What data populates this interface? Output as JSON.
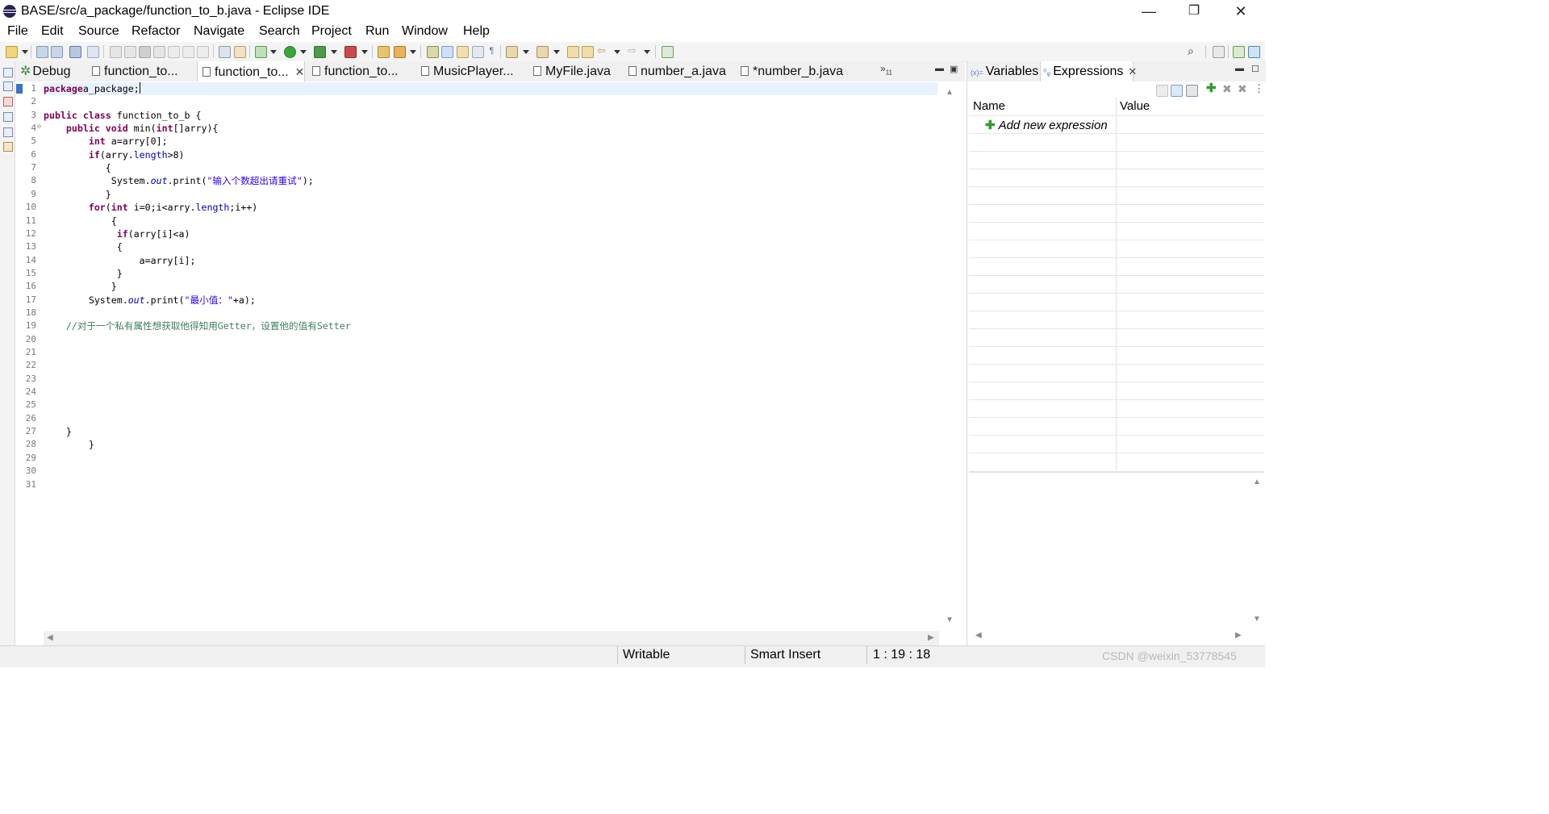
{
  "window": {
    "title": "BASE/src/a_package/function_to_b.java - Eclipse IDE",
    "controls": {
      "minimize": "—",
      "restore": "❐",
      "close": "✕"
    }
  },
  "menubar": [
    "File",
    "Edit",
    "Source",
    "Refactor",
    "Navigate",
    "Search",
    "Project",
    "Run",
    "Window",
    "Help"
  ],
  "editor_tabs": [
    {
      "label": "Debug",
      "icon": "debug-icon"
    },
    {
      "label": "function_to...",
      "icon": "java-file-icon"
    },
    {
      "label": "function_to...",
      "icon": "java-file-icon",
      "active": true,
      "close": "✕"
    },
    {
      "label": "function_to...",
      "icon": "java-file-icon"
    },
    {
      "label": "MusicPlayer...",
      "icon": "java-file-icon"
    },
    {
      "label": "MyFile.java",
      "icon": "java-file-icon"
    },
    {
      "label": "number_a.java",
      "icon": "java-file-icon"
    },
    {
      "label": "*number_b.java",
      "icon": "java-file-icon"
    }
  ],
  "more_tabs": {
    "glyph": "»",
    "count": "11"
  },
  "editor": {
    "line_numbers": [
      "1",
      "2",
      "3",
      "4",
      "5",
      "6",
      "7",
      "8",
      "9",
      "10",
      "11",
      "12",
      "13",
      "14",
      "15",
      "16",
      "17",
      "18",
      "19",
      "20",
      "21",
      "22",
      "23",
      "24",
      "25",
      "26",
      "27",
      "28",
      "29",
      "30",
      "31"
    ],
    "lines": [
      [
        [
          "kw",
          "package"
        ],
        [
          "",
          "a_package;"
        ]
      ],
      [],
      [
        [
          "kw",
          "public class"
        ],
        [
          "",
          " function_to_b {"
        ]
      ],
      [
        [
          "",
          "    "
        ],
        [
          "kw",
          "public void"
        ],
        [
          "",
          " min("
        ],
        [
          "kw",
          "int"
        ],
        [
          "",
          "[]arry){"
        ]
      ],
      [
        [
          "",
          "        "
        ],
        [
          "kw",
          "int"
        ],
        [
          "",
          " a=arry[0];"
        ]
      ],
      [
        [
          "",
          "        "
        ],
        [
          "kw",
          "if"
        ],
        [
          "",
          "(arry."
        ],
        [
          "fld",
          "length"
        ],
        [
          "",
          ">8)"
        ]
      ],
      [
        [
          "",
          "           {"
        ]
      ],
      [
        [
          "",
          "            System."
        ],
        [
          "it",
          "out"
        ],
        [
          "",
          ".print("
        ],
        [
          "str",
          "\"输入个数超出请重试\""
        ],
        [
          "",
          ");"
        ]
      ],
      [
        [
          "",
          "           }"
        ]
      ],
      [
        [
          "",
          "        "
        ],
        [
          "kw",
          "for"
        ],
        [
          "",
          "("
        ],
        [
          "kw",
          "int"
        ],
        [
          "",
          " i=0;i<arry."
        ],
        [
          "fld",
          "length"
        ],
        [
          "",
          ";i++)"
        ]
      ],
      [
        [
          "",
          "            {"
        ]
      ],
      [
        [
          "",
          "             "
        ],
        [
          "kw",
          "if"
        ],
        [
          "",
          "(arry[i]<a)"
        ]
      ],
      [
        [
          "",
          "             {"
        ]
      ],
      [
        [
          "",
          "                 a=arry[i];"
        ]
      ],
      [
        [
          "",
          "             }"
        ]
      ],
      [
        [
          "",
          "            }"
        ]
      ],
      [
        [
          "",
          "        System."
        ],
        [
          "it",
          "out"
        ],
        [
          "",
          ".print("
        ],
        [
          "str",
          "\"最小值：\""
        ],
        [
          "",
          "+a);"
        ]
      ],
      [],
      [
        [
          "",
          "    "
        ],
        [
          "cmt",
          "//对于一个私有属性想获取他得知用Getter，设置他的值有Setter"
        ]
      ],
      [],
      [],
      [],
      [],
      [],
      [],
      [],
      [
        [
          "",
          "    }"
        ]
      ],
      [
        [
          "",
          "        }"
        ]
      ],
      [],
      [],
      []
    ]
  },
  "right_panel": {
    "tabs": [
      {
        "label": "Variables",
        "icon": "variables-icon"
      },
      {
        "label": "Expressions",
        "icon": "expressions-icon",
        "active": true,
        "close": "✕"
      }
    ],
    "columns": {
      "name": "Name",
      "value": "Value"
    },
    "add_expression": "Add new expression"
  },
  "status": {
    "writable": "Writable",
    "insert_mode": "Smart Insert",
    "position": "1 : 19 : 18"
  },
  "watermark": "CSDN @weixin_53778545",
  "colors": {
    "keyword": "#7f0055",
    "string": "#2a00ff",
    "field": "#0000c0",
    "comment": "#3f7f5f",
    "current_line": "#e8f2fe"
  }
}
